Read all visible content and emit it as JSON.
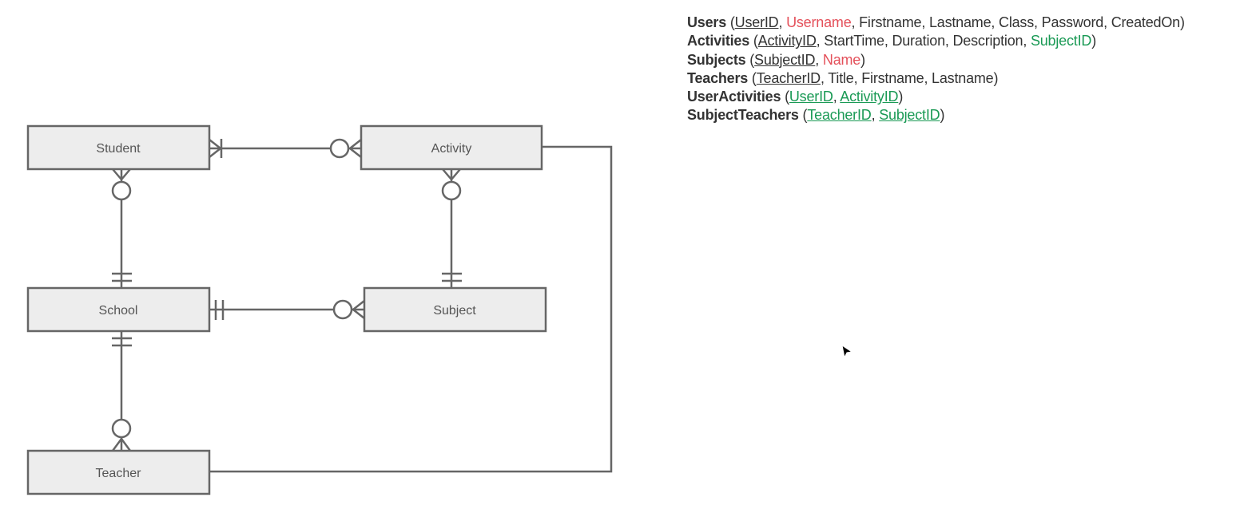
{
  "diagram": {
    "entities": {
      "student": "Student",
      "activity": "Activity",
      "school": "School",
      "subject": "Subject",
      "teacher": "Teacher"
    },
    "relationships": [
      {
        "from": "Student",
        "to": "Activity",
        "from_card": "one-or-many",
        "to_card": "zero-or-many"
      },
      {
        "from": "Student",
        "to": "School",
        "from_card": "zero-or-many",
        "to_card": "exactly-one"
      },
      {
        "from": "Activity",
        "to": "Subject",
        "from_card": "zero-or-many",
        "to_card": "exactly-one"
      },
      {
        "from": "School",
        "to": "Subject",
        "from_card": "exactly-one",
        "to_card": "zero-or-many"
      },
      {
        "from": "School",
        "to": "Teacher",
        "from_card": "exactly-one",
        "to_card": "zero-or-many"
      },
      {
        "from": "Activity",
        "to": "Teacher",
        "from_card": "none",
        "to_card": "none"
      }
    ]
  },
  "schema": [
    {
      "table": "Users",
      "fields": [
        {
          "name": "UserID",
          "pk": true,
          "fk": false,
          "unique": false
        },
        {
          "name": "Username",
          "pk": false,
          "fk": false,
          "unique": true
        },
        {
          "name": "Firstname"
        },
        {
          "name": "Lastname"
        },
        {
          "name": "Class"
        },
        {
          "name": "Password"
        },
        {
          "name": "CreatedOn"
        }
      ]
    },
    {
      "table": "Activities",
      "fields": [
        {
          "name": "ActivityID",
          "pk": true
        },
        {
          "name": "StartTime"
        },
        {
          "name": "Duration"
        },
        {
          "name": "Description"
        },
        {
          "name": "SubjectID",
          "fk": true
        }
      ]
    },
    {
      "table": "Subjects",
      "fields": [
        {
          "name": "SubjectID",
          "pk": true
        },
        {
          "name": "Name",
          "unique": true
        }
      ]
    },
    {
      "table": "Teachers",
      "fields": [
        {
          "name": "TeacherID",
          "pk": true
        },
        {
          "name": "Title"
        },
        {
          "name": "Firstname"
        },
        {
          "name": "Lastname"
        }
      ]
    },
    {
      "table": "UserActivities",
      "fields": [
        {
          "name": "UserID",
          "pk": true,
          "fk": true
        },
        {
          "name": "ActivityID",
          "pk": true,
          "fk": true
        }
      ]
    },
    {
      "table": "SubjectTeachers",
      "fields": [
        {
          "name": "TeacherID",
          "pk": true,
          "fk": true
        },
        {
          "name": "SubjectID",
          "pk": true,
          "fk": true
        }
      ]
    }
  ],
  "colors": {
    "unique": "#e4505a",
    "foreign_key": "#1a9a55",
    "line": "#666666",
    "entity_fill": "#ededed"
  }
}
